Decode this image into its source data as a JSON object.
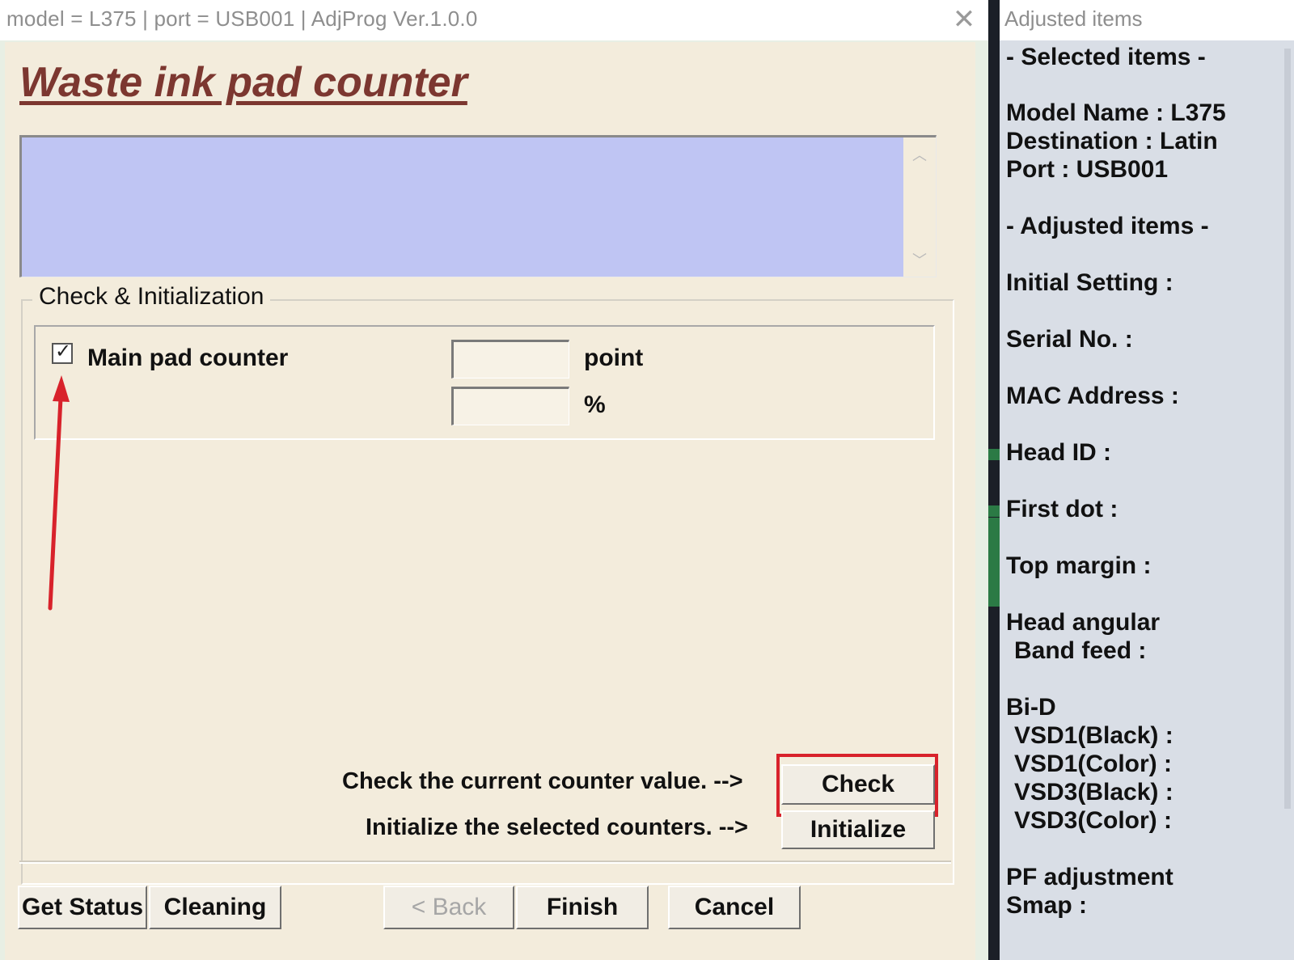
{
  "window": {
    "title": "model = L375 | port = USB001 | AdjProg Ver.1.0.0",
    "close_glyph": "✕"
  },
  "main": {
    "heading": "Waste ink pad counter",
    "group_title": "Check & Initialization",
    "counter": {
      "label": "Main pad counter",
      "checked": true,
      "point_value": "",
      "percent_value": "",
      "point_unit": "point",
      "percent_unit": "%"
    },
    "check_hint": "Check the current counter value. -->",
    "check_button": "Check",
    "init_hint": "Initialize the selected counters. -->",
    "init_button": "Initialize"
  },
  "footer": {
    "get_status": "Get Status",
    "cleaning": "Cleaning",
    "back": "< Back",
    "finish": "Finish",
    "cancel": "Cancel"
  },
  "side": {
    "header": "Adjusted items",
    "selected_title": "- Selected items -",
    "model_name": "Model Name : L375",
    "destination": "Destination : Latin",
    "port": "Port : USB001",
    "adjusted_title": "- Adjusted items -",
    "initial_setting": "Initial Setting :",
    "serial_no": "Serial No. :",
    "mac_address": "MAC Address :",
    "head_id": "Head ID :",
    "first_dot": "First dot :",
    "top_margin": "Top margin :",
    "head_angular": "Head angular",
    "band_feed": "Band feed :",
    "bid": "Bi-D",
    "vsd1_black": "VSD1(Black) :",
    "vsd1_color": "VSD1(Color) :",
    "vsd3_black": "VSD3(Black) :",
    "vsd3_color": "VSD3(Color) :",
    "pf_adjustment": "PF adjustment",
    "smap": "Smap :"
  },
  "colors": {
    "accent_red": "#d8222b",
    "title_brown": "#7c3730",
    "output_blue": "#bfc5f3",
    "panel_beige": "#f3ecdc"
  }
}
